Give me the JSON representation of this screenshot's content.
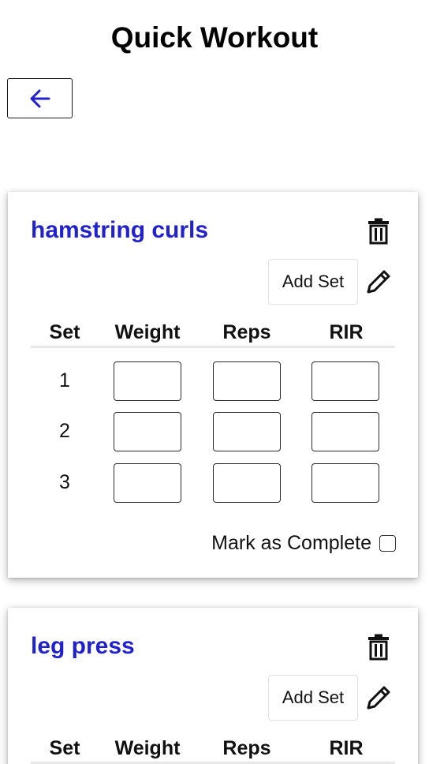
{
  "page": {
    "title": "Quick Workout"
  },
  "header": {
    "back_icon": "arrow-left-icon"
  },
  "table_headers": {
    "set": "Set",
    "weight": "Weight",
    "reps": "Reps",
    "rir": "RIR"
  },
  "exercises": [
    {
      "name": "hamstring curls",
      "add_set_label": "Add Set",
      "sets": [
        {
          "number": "1",
          "weight": "",
          "reps": "",
          "rir": ""
        },
        {
          "number": "2",
          "weight": "",
          "reps": "",
          "rir": ""
        },
        {
          "number": "3",
          "weight": "",
          "reps": "",
          "rir": ""
        }
      ],
      "complete_label": "Mark as Complete",
      "completed": false
    },
    {
      "name": "leg press",
      "add_set_label": "Add Set"
    }
  ],
  "colors": {
    "exercise_title": "#2222cc",
    "back_arrow": "#2222cc"
  }
}
